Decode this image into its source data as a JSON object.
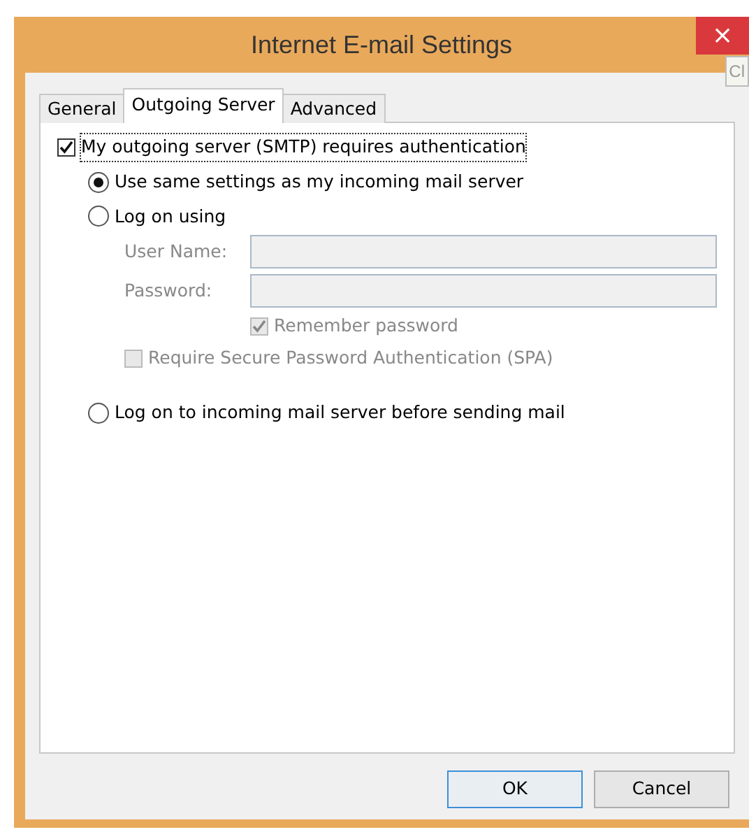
{
  "window": {
    "title": "Internet E-mail Settings",
    "close": "×"
  },
  "tooltip": {
    "text": "Cl"
  },
  "tabs": [
    {
      "label": "General",
      "selected": false
    },
    {
      "label": "Outgoing Server",
      "selected": true
    },
    {
      "label": "Advanced",
      "selected": false
    }
  ],
  "auth": {
    "label": "My outgoing server (SMTP) requires authentication",
    "checked": true,
    "focused": true,
    "options": [
      {
        "label": "Use same settings as my incoming mail server",
        "selected": true
      },
      {
        "label": "Log on using",
        "selected": false,
        "children": [
          {
            "kind": "field",
            "label": "User Name:",
            "disabled": true
          },
          {
            "kind": "field",
            "label": "Password:",
            "disabled": true
          },
          {
            "kind": "checkbox",
            "label": "Remember password",
            "checked": true,
            "disabled": true
          },
          {
            "kind": "checkbox",
            "label": "Require Secure Password Authentication (SPA)",
            "checked": false,
            "disabled": true
          }
        ]
      },
      {
        "label": "Log on to incoming mail server before sending mail",
        "selected": false
      }
    ]
  },
  "buttons": [
    {
      "label": "OK",
      "default": true
    },
    {
      "label": "Cancel",
      "default": false
    }
  ]
}
